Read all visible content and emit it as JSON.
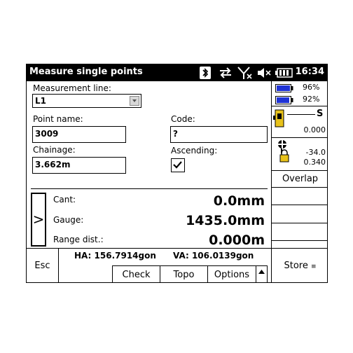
{
  "window": {
    "title": "Measure single points",
    "clock": "16:34"
  },
  "status_icons": [
    "bluetooth-icon",
    "sync-icon",
    "antenna-off-icon",
    "speaker-muted-icon",
    "battery-icon"
  ],
  "form": {
    "measurement_line_label": "Measurement line:",
    "measurement_line_value": "L1",
    "point_name_label": "Point name:",
    "point_name_value": "3009",
    "code_label": "Code:",
    "code_value": "?",
    "chainage_label": "Chainage:",
    "chainage_value": "3.662m",
    "ascending_label": "Ascending:",
    "ascending_checked": true
  },
  "readings": {
    "cant_label": "Cant:",
    "cant_value": "0.0mm",
    "gauge_label": "Gauge:",
    "gauge_value": "1435.0mm",
    "range_label": "Range dist.:",
    "range_value": "0.000m",
    "expand_glyph": ">"
  },
  "angles": {
    "ha": "HA: 156.7914gon",
    "va": "VA: 106.0139gon"
  },
  "buttons": {
    "esc": "Esc",
    "check": "Check",
    "topo": "Topo",
    "options": "Options",
    "store": "Store"
  },
  "sidebar": {
    "battery1": "96%",
    "battery2": "92%",
    "prism_label": "S",
    "prism_value": "0.000",
    "tilt_value1": "-34.0",
    "tilt_value2": "0.340",
    "overlap": "Overlap"
  },
  "colors": {
    "battery_fill": "#1f33d6",
    "instrument_yellow": "#e8c21a"
  }
}
